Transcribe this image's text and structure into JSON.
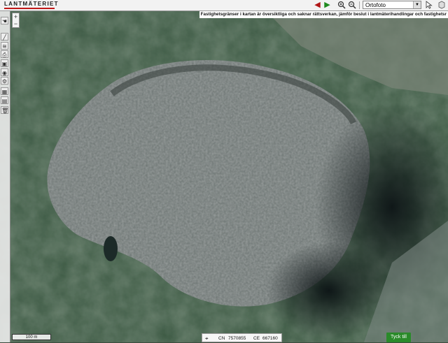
{
  "header": {
    "logo_text": "LANTMÄTERIET",
    "brand_color": "#c01818",
    "layer_select": {
      "selected": "Ortofoto"
    }
  },
  "icons": {
    "back": "arrow-left-icon",
    "forward": "arrow-right-icon",
    "zoom_in": "zoom-in-icon",
    "zoom_out": "zoom-out-icon"
  },
  "notice": {
    "text": "Fastighetsgränser i kartan är översiktliga och saknar rättsverkan, jämför beslut i lantmäterihandlingar och fastighetsr"
  },
  "zoom": {
    "plus": "+",
    "minus": "−"
  },
  "scale": {
    "label": "100 m"
  },
  "coordinates": {
    "n_label": "CN",
    "n_value": "7570855",
    "e_label": "CE",
    "e_value": "667160"
  },
  "feedback": {
    "label": "Tyck till",
    "color": "#2a8a2a"
  }
}
